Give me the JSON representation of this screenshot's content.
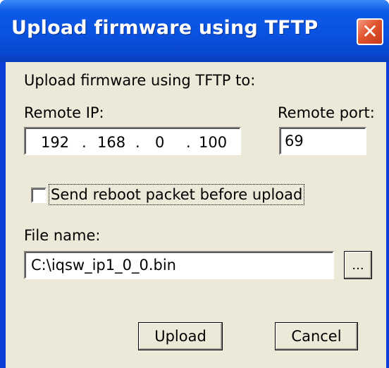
{
  "window": {
    "title": "Upload firmware using TFTP",
    "close_label": "✕"
  },
  "dialog": {
    "heading": "Upload firmware using TFTP to:",
    "remote_ip_label": "Remote IP:",
    "remote_ip": [
      "192",
      "168",
      "0",
      "100"
    ],
    "ip_separator": ".",
    "remote_port_label": "Remote port:",
    "remote_port_value": "69",
    "reboot_checkbox_label": "Send reboot packet before upload",
    "reboot_checked": false,
    "file_name_label": "File name:",
    "file_name_value": "C:\\iqsw_ip1_0_0.bin",
    "browse_label": "...",
    "upload_label": "Upload",
    "cancel_label": "Cancel"
  },
  "colors": {
    "titlebar": "#0a52df",
    "client_bg": "#ece9d8",
    "close_button": "#e1542f"
  }
}
